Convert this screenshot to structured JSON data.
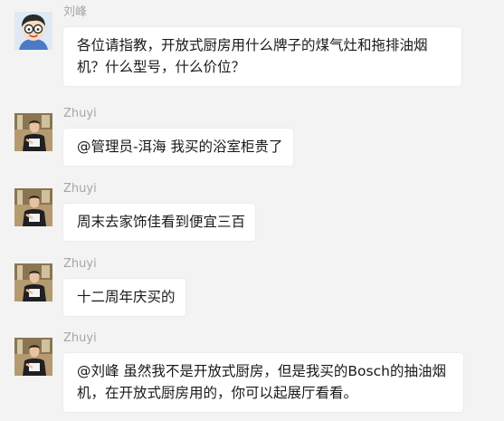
{
  "messages": [
    {
      "sender": "刘峰",
      "text": "各位请指教，开放式厨房用什么牌子的煤气灶和拖排油烟机？什么型号，什么价位？",
      "avatar": "cartoon-avatar"
    },
    {
      "sender": "Zhuyi",
      "text": "@管理员-洱海 我买的浴室柜贵了",
      "avatar": "photo-avatar"
    },
    {
      "sender": "Zhuyi",
      "text": "周末去家饰佳看到便宜三百",
      "avatar": "photo-avatar"
    },
    {
      "sender": "Zhuyi",
      "text": "十二周年庆买的",
      "avatar": "photo-avatar"
    },
    {
      "sender": "Zhuyi",
      "text": "@刘峰 虽然我不是开放式厨房，但是我买的Bosch的抽油烟机，在开放式厨房用的，你可以起展厅看看。",
      "avatar": "photo-avatar"
    }
  ],
  "colors": {
    "background": "#f3f3f3",
    "bubble": "#ffffff",
    "sender": "#a6a6a6",
    "text": "#191919"
  }
}
